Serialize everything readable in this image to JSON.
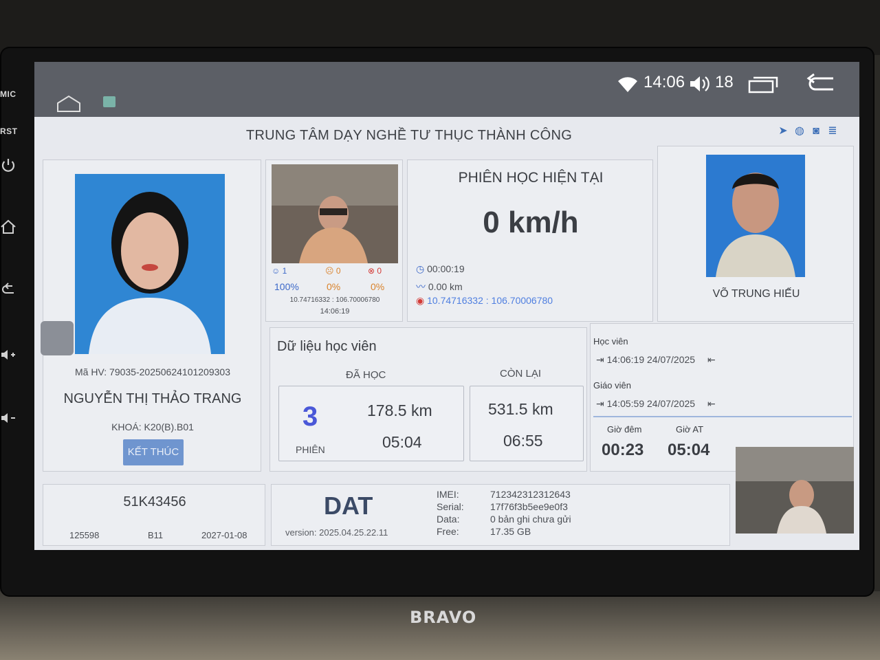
{
  "device": {
    "side_buttons": [
      "MIC",
      "RST"
    ],
    "brand": "BRAVO"
  },
  "statusbar": {
    "time": "14:06",
    "volume": "18",
    "icons": [
      "home-icon",
      "app-icon",
      "wifi-icon",
      "volume-icon",
      "recent-apps-icon",
      "back-icon"
    ]
  },
  "header": {
    "title": "TRUNG TÂM DẠY NGHỀ TƯ THỤC THÀNH CÔNG",
    "icons": [
      "navigation-icon",
      "globe-icon",
      "camera-icon",
      "database-icon"
    ]
  },
  "student": {
    "id": "Mã HV: 79035-20250624101209303",
    "name": "NGUYỄN THỊ THẢO TRANG",
    "course": "KHOÁ: K20(B).B01",
    "end_button": "KẾT THÚC"
  },
  "camera": {
    "stats": [
      {
        "icon": "smile-icon",
        "count": "1",
        "percent": "100%"
      },
      {
        "icon": "neutral-icon",
        "count": "0",
        "percent": "0%"
      },
      {
        "icon": "close-circle-icon",
        "count": "0",
        "percent": "0%"
      }
    ],
    "coords": "10.74716332 : 106.70006780",
    "time": "14:06:19"
  },
  "session": {
    "title": "PHIÊN HỌC HIỆN TẠI",
    "speed": "0 km/h",
    "duration": "00:00:19",
    "distance": "0.00 km",
    "gps": "10.74716332 : 106.70006780"
  },
  "teacher": {
    "name": "VÕ TRUNG HIẾU"
  },
  "learning": {
    "title": "Dữ liệu học viên",
    "done_label": "ĐÃ HỌC",
    "remain_label": "CÒN LẠI",
    "sessions": "3",
    "sessions_label": "PHIÊN",
    "done_km": "178.5 km",
    "done_time": "05:04",
    "remain_km": "531.5 km",
    "remain_time": "06:55"
  },
  "login": {
    "student_label": "Học viên",
    "student_time": "14:06:19 24/07/2025",
    "teacher_label": "Giáo viên",
    "teacher_time": "14:05:59 24/07/2025",
    "night_label": "Giờ đêm",
    "at_label": "Giờ AT",
    "night_value": "00:23",
    "at_value": "05:04"
  },
  "vehicle": {
    "plate": "51K43456",
    "code": "125598",
    "class": "B11",
    "expiry": "2027-01-08"
  },
  "device_info": {
    "name": "DAT",
    "version": "version: 2025.04.25.22.11",
    "imei_label": "IMEI:",
    "imei": "712342312312643",
    "serial_label": "Serial:",
    "serial": "17f76f3b5ee9e0f3",
    "data_label": "Data:",
    "data": "0 bản ghi chưa gửi",
    "free_label": "Free:",
    "free": "17.35 GB"
  },
  "colors": {
    "accent": "#3c68c8",
    "panel_bg": "#eceef2",
    "statusbar": "#5c5f66"
  }
}
